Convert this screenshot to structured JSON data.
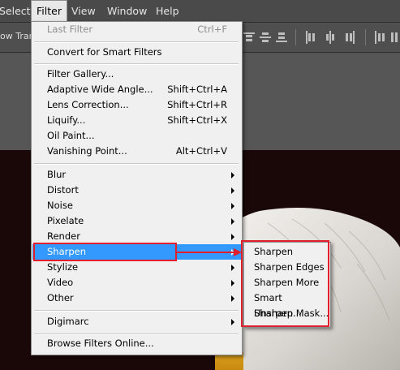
{
  "menubar": {
    "items": [
      "Select",
      "Filter",
      "View",
      "Window",
      "Help"
    ]
  },
  "options_bar": {
    "transform_label": "ow Trans"
  },
  "filter_menu": {
    "last_filter": {
      "label": "Last Filter",
      "shortcut": "Ctrl+F",
      "enabled": false
    },
    "convert_smart": "Convert for Smart Filters",
    "group1": [
      {
        "label": "Filter Gallery...",
        "shortcut": ""
      },
      {
        "label": "Adaptive Wide Angle...",
        "shortcut": "Shift+Ctrl+A"
      },
      {
        "label": "Lens Correction...",
        "shortcut": "Shift+Ctrl+R"
      },
      {
        "label": "Liquify...",
        "shortcut": "Shift+Ctrl+X"
      },
      {
        "label": "Oil Paint...",
        "shortcut": ""
      },
      {
        "label": "Vanishing Point...",
        "shortcut": "Alt+Ctrl+V"
      }
    ],
    "submenus": [
      "Blur",
      "Distort",
      "Noise",
      "Pixelate",
      "Render",
      "Sharpen",
      "Stylize",
      "Video",
      "Other"
    ],
    "selected": "Sharpen",
    "digimarc": "Digimarc",
    "browse_online": "Browse Filters Online..."
  },
  "sharpen_submenu": {
    "items": [
      "Sharpen",
      "Sharpen Edges",
      "Sharpen More",
      "Smart Sharpen...",
      "Unsharp Mask..."
    ]
  },
  "colors": {
    "menu_bg": "#f0f0f0",
    "highlight": "#3399ff",
    "annotation": "#e0202c"
  }
}
